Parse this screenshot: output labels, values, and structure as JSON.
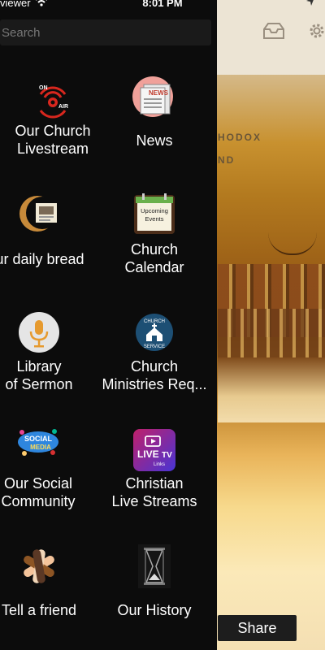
{
  "status_bar": {
    "carrier": "viewer",
    "time": "8:01 PM"
  },
  "search": {
    "placeholder": "Search",
    "value": ""
  },
  "menu": [
    {
      "label_line1": "Our Church",
      "label_line2": "Livestream",
      "icon": "on-air-icon"
    },
    {
      "label_line1": "News",
      "label_line2": "",
      "icon": "news-icon"
    },
    {
      "label_line1": "ur daily bread",
      "label_line2": "",
      "icon": "daily-bread-icon"
    },
    {
      "label_line1": "Church",
      "label_line2": "Calendar",
      "icon": "calendar-icon",
      "icon_text_1": "Upcoming",
      "icon_text_2": "Events"
    },
    {
      "label_line1": "Library",
      "label_line2": "of Sermon",
      "icon": "microphone-icon"
    },
    {
      "label_line1": "Church",
      "label_line2": "Ministries Req...",
      "icon": "church-service-icon",
      "icon_text_1": "CHURCH",
      "icon_text_2": "SERVICE"
    },
    {
      "label_line1": "Our Social",
      "label_line2": "Community",
      "icon": "social-media-icon",
      "icon_text_1": "SOCIAL",
      "icon_text_2": "MEDIA"
    },
    {
      "label_line1": "Christian",
      "label_line2": "Live Streams",
      "icon": "live-tv-icon",
      "icon_text_1": "LIVE",
      "icon_text_2": "Links"
    },
    {
      "label_line1": "Tell a friend",
      "label_line2": "",
      "icon": "hands-icon"
    },
    {
      "label_line1": "Our History",
      "label_line2": "",
      "icon": "hourglass-icon"
    }
  ],
  "background": {
    "title_line1": "HODOX",
    "title_line2": "ND",
    "share_label": "Share"
  },
  "colors": {
    "drawer_bg": "#0c0c0c",
    "accent_red": "#d8271e"
  }
}
